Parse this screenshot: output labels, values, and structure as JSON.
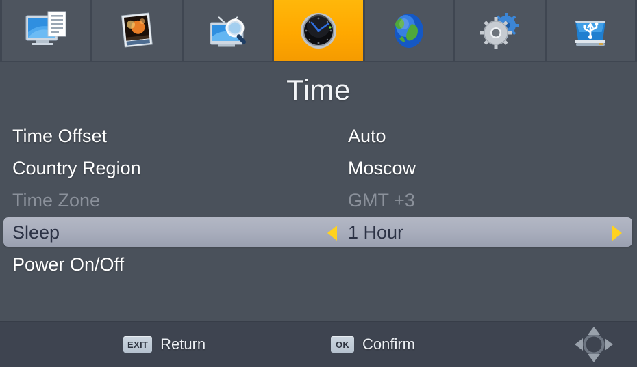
{
  "tabs": [
    {
      "id": "picture",
      "icon": "monitor-document-icon",
      "label": "Picture",
      "selected": false
    },
    {
      "id": "media",
      "icon": "photo-icon",
      "label": "Media",
      "selected": false
    },
    {
      "id": "search",
      "icon": "tv-search-icon",
      "label": "Search",
      "selected": false
    },
    {
      "id": "time",
      "icon": "clock-icon",
      "label": "Time",
      "selected": true
    },
    {
      "id": "network",
      "icon": "globe-icon",
      "label": "Network",
      "selected": false
    },
    {
      "id": "system",
      "icon": "gears-icon",
      "label": "System",
      "selected": false
    },
    {
      "id": "usb",
      "icon": "usb-drive-icon",
      "label": "USB",
      "selected": false
    }
  ],
  "page": {
    "title": "Time"
  },
  "menu": {
    "rows": [
      {
        "label": "Time Offset",
        "value": "Auto",
        "state": "normal",
        "arrows": false
      },
      {
        "label": "Country Region",
        "value": "Moscow",
        "state": "normal",
        "arrows": false
      },
      {
        "label": "Time Zone",
        "value": "GMT +3",
        "state": "disabled",
        "arrows": false
      },
      {
        "label": "Sleep",
        "value": "1 Hour",
        "state": "selected",
        "arrows": true
      },
      {
        "label": "Power On/Off",
        "value": "",
        "state": "normal",
        "arrows": false
      }
    ]
  },
  "footer": {
    "hints": [
      {
        "key": "EXIT",
        "label": "Return"
      },
      {
        "key": "OK",
        "label": "Confirm"
      }
    ],
    "navigation_icon": "dpad-icon"
  },
  "colors": {
    "background": "#4a515b",
    "tabbar": "#4e555f",
    "selected_tab": "#ffa800",
    "highlight_row": "#a9aebd",
    "arrow": "#ffd21e",
    "bottombar": "#3e4450",
    "text": "#ffffff",
    "text_disabled": "#8b919b",
    "text_selected": "#2c3245"
  }
}
